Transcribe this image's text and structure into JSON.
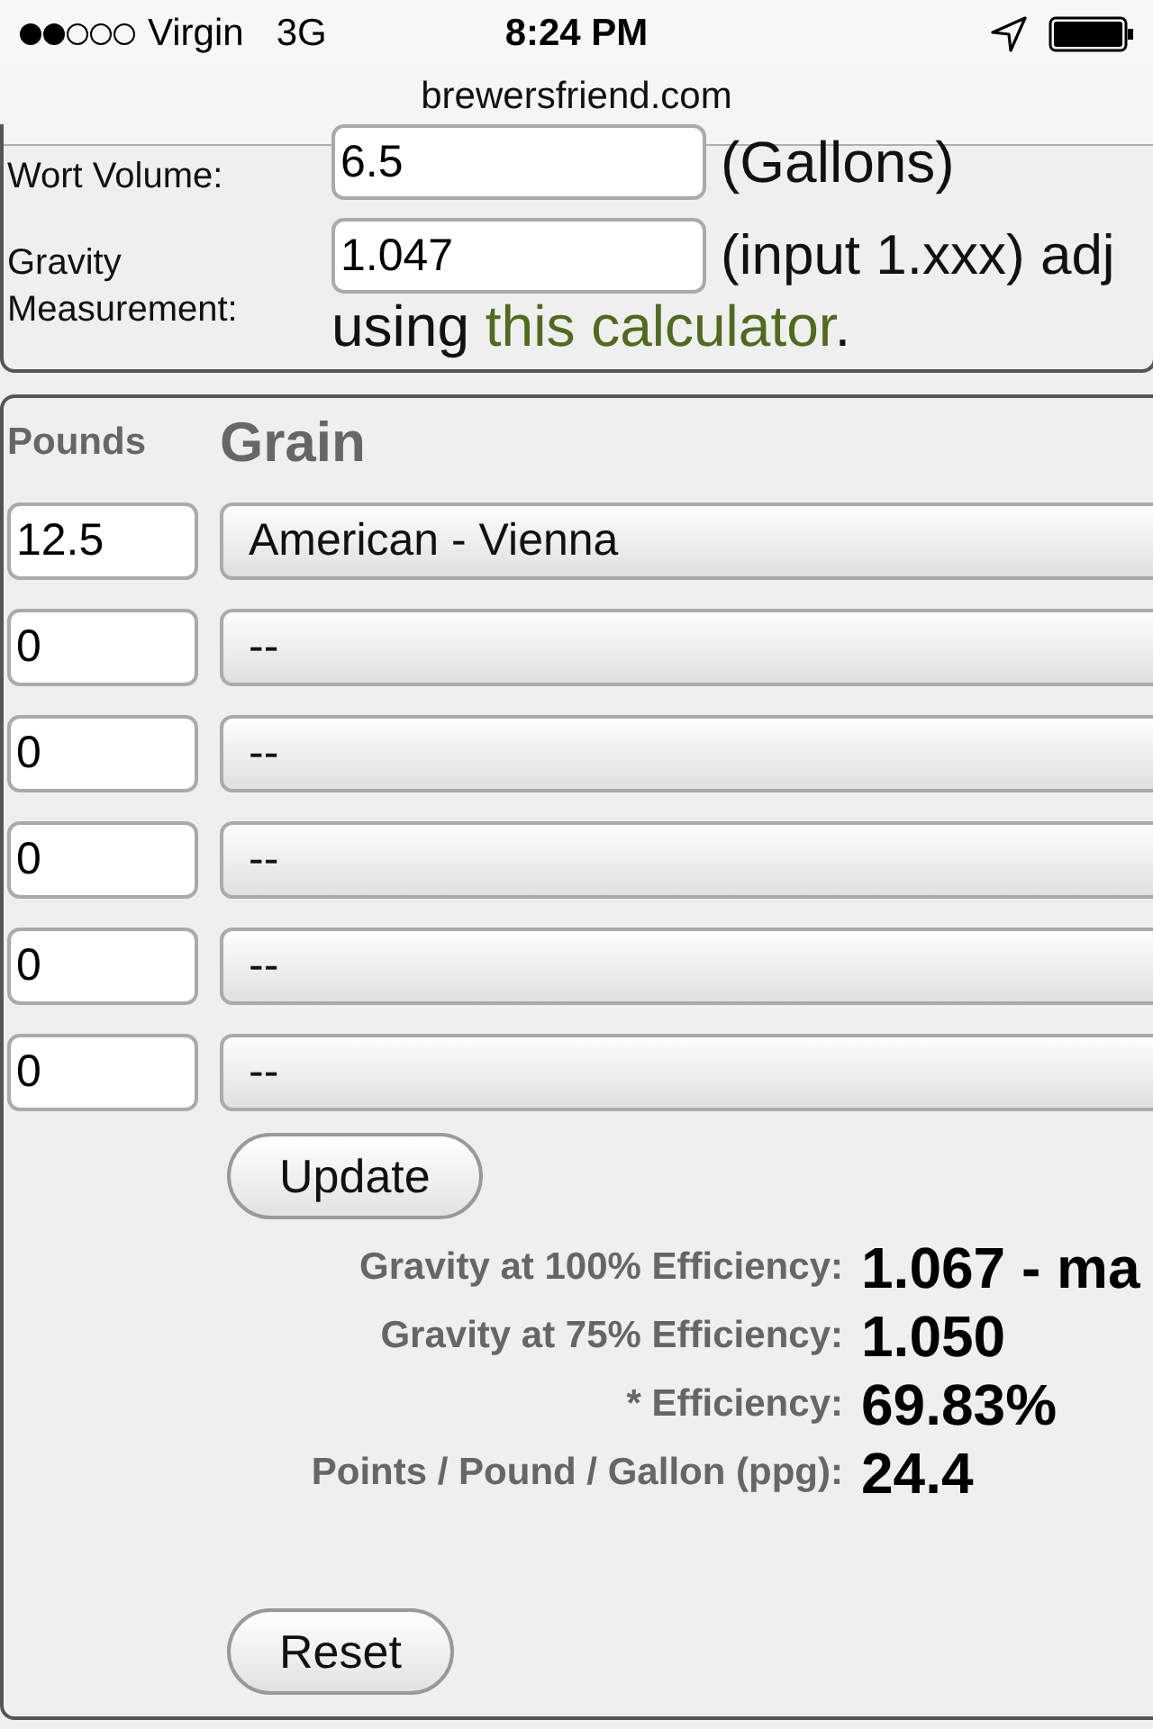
{
  "status_bar": {
    "carrier": "Virgin",
    "network": "3G",
    "time": "8:24 PM"
  },
  "url_bar": {
    "domain": "brewersfriend.com"
  },
  "volume": {
    "label": "Wort Volume:",
    "value": "6.5",
    "unit": "(Gallons)"
  },
  "gravity": {
    "label": "Gravity Measurement:",
    "value": "1.047",
    "hint": "(input 1.xxx) adj",
    "note_prefix": "using ",
    "link": "this calculator",
    "note_suffix": "."
  },
  "grain_table": {
    "columns": [
      "Pounds",
      "Grain"
    ],
    "rows": [
      {
        "pounds": "12.5",
        "grain": "American - Vienna"
      },
      {
        "pounds": "0",
        "grain": "--"
      },
      {
        "pounds": "0",
        "grain": "--"
      },
      {
        "pounds": "0",
        "grain": "--"
      },
      {
        "pounds": "0",
        "grain": "--"
      },
      {
        "pounds": "0",
        "grain": "--"
      }
    ]
  },
  "update_button": "Update",
  "results": [
    {
      "label": "Gravity at 100% Efficiency:",
      "value": "1.067 - ma"
    },
    {
      "label": "Gravity at 75% Efficiency:",
      "value": "1.050"
    },
    {
      "label": "* Efficiency:",
      "value": "69.83%"
    },
    {
      "label": "Points / Pound / Gallon (ppg):",
      "value": "24.4"
    }
  ],
  "reset_button": "Reset"
}
